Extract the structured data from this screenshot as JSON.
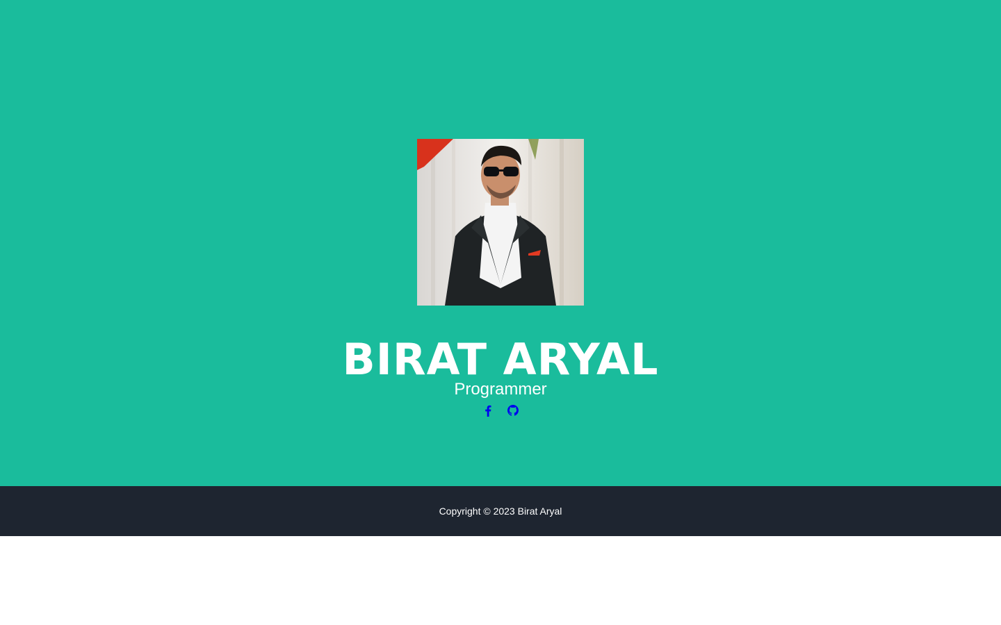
{
  "hero": {
    "name": "BIRAT ARYAL",
    "role": "Programmer",
    "background_color": "#1abc9c"
  },
  "socials": [
    {
      "icon": "facebook-icon",
      "label": "Facebook"
    },
    {
      "icon": "github-icon",
      "label": "GitHub"
    }
  ],
  "footer": {
    "copyright": "Copyright © 2023 Birat Aryal",
    "background_color": "#1e2530"
  }
}
